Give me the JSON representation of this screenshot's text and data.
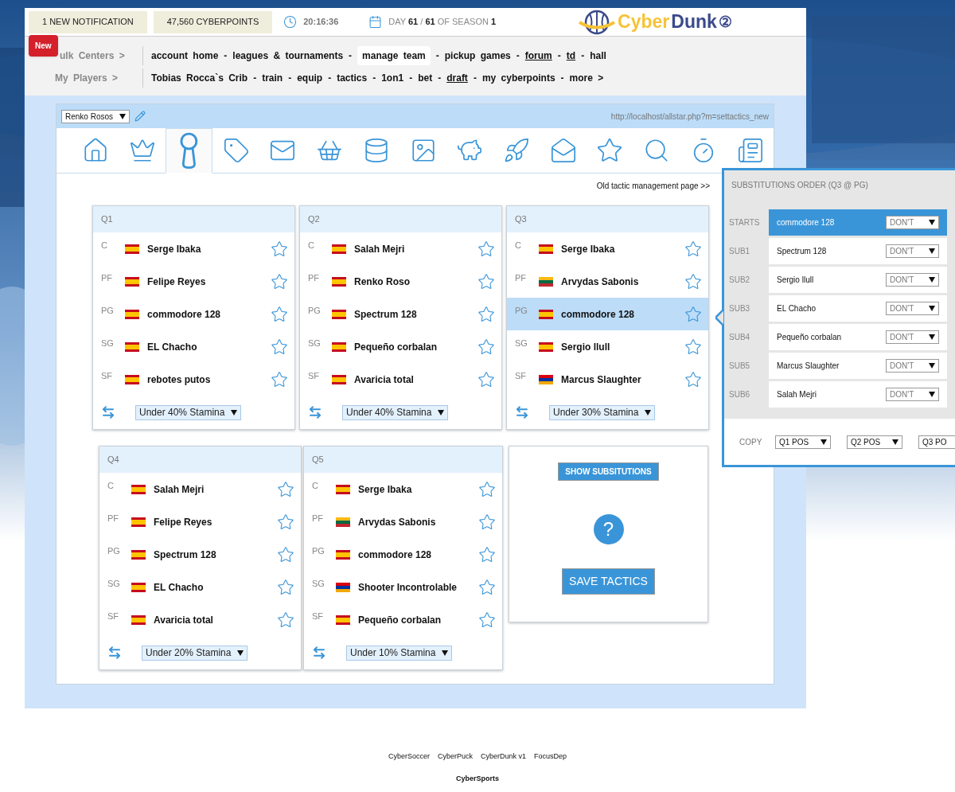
{
  "header": {
    "notification": "1 NEW NOTIFICATION",
    "badge": "New",
    "points": "47,560 CYBERPOINTS",
    "time": "20:16:36",
    "day": "DAY **61** / **61** OF SEASON **1**",
    "logo": [
      "Cyber",
      "Dunk",
      "②"
    ]
  },
  "nav": [
    {
      "label": "ulk Centers >",
      "separator": "-",
      "items": [
        {
          "text": "account home",
          "underlined": false,
          "selected": false
        },
        {
          "text": "leagues & tournaments",
          "underlined": false,
          "selected": false
        },
        {
          "text": "manage team",
          "underlined": false,
          "selected": true
        },
        {
          "text": "pickup games",
          "underlined": false,
          "selected": false
        },
        {
          "text": "forum",
          "underlined": true,
          "selected": false
        },
        {
          "text": "td",
          "underlined": true,
          "selected": false
        },
        {
          "text": "hall",
          "underlined": false,
          "selected": false
        }
      ]
    },
    {
      "label": "My Players >",
      "separator": "-",
      "items": [
        {
          "text": "Tobias Rocca`s Crib",
          "underlined": false,
          "selected": false
        },
        {
          "text": "train",
          "underlined": false,
          "selected": false
        },
        {
          "text": "equip",
          "underlined": false,
          "selected": false
        },
        {
          "text": "tactics",
          "underlined": false,
          "selected": false
        },
        {
          "text": "1on1",
          "underlined": false,
          "selected": false
        },
        {
          "text": "bet",
          "underlined": false,
          "selected": false
        },
        {
          "text": "draft",
          "underlined": true,
          "selected": false
        },
        {
          "text": "my cyberpoints",
          "underlined": false,
          "selected": false
        },
        {
          "text": "more >",
          "underlined": false,
          "selected": false
        }
      ]
    }
  ],
  "panel": {
    "player_select": "Renko Rosos",
    "url": "http://localhost/allstar.php?m=settactics_new",
    "old_link": "Old tactic management page >>"
  },
  "toolbar": [
    {
      "selected": false
    },
    {
      "selected": false
    },
    {
      "selected": true
    },
    {
      "selected": false
    },
    {
      "selected": false
    },
    {
      "selected": false
    },
    {
      "selected": false
    },
    {
      "selected": false
    },
    {
      "selected": false
    },
    {
      "selected": false
    },
    {
      "selected": false
    },
    {
      "selected": false
    },
    {
      "selected": false
    },
    {
      "selected": false
    },
    {
      "selected": false
    }
  ],
  "quarters": [
    {
      "title": "Q1",
      "stamina": "Under 40% Stamina",
      "rows": [
        {
          "pos": "C",
          "kind": "spain",
          "name": "Serge Ibaka",
          "selected": false
        },
        {
          "pos": "PF",
          "kind": "spain",
          "name": "Felipe Reyes",
          "selected": false
        },
        {
          "pos": "PG",
          "kind": "spain",
          "name": "commodore 128",
          "selected": false
        },
        {
          "pos": "SG",
          "kind": "spain",
          "name": "EL Chacho",
          "selected": false
        },
        {
          "pos": "SF",
          "kind": "spain",
          "name": "rebotes putos",
          "selected": false
        }
      ]
    },
    {
      "title": "Q2",
      "stamina": "Under 40% Stamina",
      "rows": [
        {
          "pos": "C",
          "kind": "spain",
          "name": "Salah Mejri",
          "selected": false
        },
        {
          "pos": "PF",
          "kind": "spain",
          "name": "Renko Roso",
          "selected": false
        },
        {
          "pos": "PG",
          "kind": "spain",
          "name": "Spectrum 128",
          "selected": false
        },
        {
          "pos": "SG",
          "kind": "spain",
          "name": "Pequeño corbalan",
          "selected": false
        },
        {
          "pos": "SF",
          "kind": "spain",
          "name": "Avaricia total",
          "selected": false
        }
      ]
    },
    {
      "title": "Q3",
      "stamina": "Under 30% Stamina",
      "rows": [
        {
          "pos": "C",
          "kind": "spain",
          "name": "Serge Ibaka",
          "selected": false
        },
        {
          "pos": "PF",
          "kind": "lithuania",
          "name": "Arvydas Sabonis",
          "selected": false
        },
        {
          "pos": "PG",
          "kind": "spain",
          "name": "commodore 128",
          "selected": true
        },
        {
          "pos": "SG",
          "kind": "spain",
          "name": "Sergio llull",
          "selected": false
        },
        {
          "pos": "SF",
          "kind": "armenia",
          "name": "Marcus Slaughter",
          "selected": false
        }
      ]
    },
    {
      "title": "Q4",
      "stamina": "Under 20% Stamina",
      "rows": [
        {
          "pos": "C",
          "kind": "spain",
          "name": "Salah Mejri",
          "selected": false
        },
        {
          "pos": "PF",
          "kind": "spain",
          "name": "Felipe Reyes",
          "selected": false
        },
        {
          "pos": "PG",
          "kind": "spain",
          "name": "Spectrum 128",
          "selected": false
        },
        {
          "pos": "SG",
          "kind": "spain",
          "name": "EL Chacho",
          "selected": false
        },
        {
          "pos": "SF",
          "kind": "spain",
          "name": "Avaricia total",
          "selected": false
        }
      ]
    },
    {
      "title": "Q5",
      "stamina": "Under 10% Stamina",
      "rows": [
        {
          "pos": "C",
          "kind": "spain",
          "name": "Serge Ibaka",
          "selected": false
        },
        {
          "pos": "PF",
          "kind": "lithuania",
          "name": "Arvydas Sabonis",
          "selected": false
        },
        {
          "pos": "PG",
          "kind": "spain",
          "name": "commodore 128",
          "selected": false
        },
        {
          "pos": "SG",
          "kind": "armenia",
          "name": "Shooter Incontrolable",
          "selected": false
        },
        {
          "pos": "SF",
          "kind": "spain",
          "name": "Pequeño corbalan",
          "selected": false
        }
      ]
    }
  ],
  "actions": {
    "show": "SHOW SUBSITUTIONS",
    "help": "?",
    "save": "SAVE TACTICS"
  },
  "substitutions": {
    "title": "SUBSTITUTIONS ORDER (Q3 @ PG)",
    "rows": [
      {
        "label": "STARTS",
        "name": "commodore 128",
        "choice": "DON'T",
        "selected": true
      },
      {
        "label": "SUB1",
        "name": "Spectrum 128",
        "choice": "DON'T",
        "selected": false
      },
      {
        "label": "SUB2",
        "name": "Sergio llull",
        "choice": "DON'T",
        "selected": false
      },
      {
        "label": "SUB3",
        "name": "EL Chacho",
        "choice": "DON'T",
        "selected": false
      },
      {
        "label": "SUB4",
        "name": "Pequeño corbalan",
        "choice": "DON'T",
        "selected": false
      },
      {
        "label": "SUB5",
        "name": "Marcus Slaughter",
        "choice": "DON'T",
        "selected": false
      },
      {
        "label": "SUB6",
        "name": "Salah Mejri",
        "choice": "DON'T",
        "selected": false
      }
    ],
    "copy_label": "COPY",
    "copy": [
      "Q1 POS",
      "Q2 POS",
      "Q3 PO"
    ]
  },
  "footer": {
    "links": [
      "CyberSoccer",
      "CyberPuck",
      "CyberDunk v1",
      "FocusDep"
    ],
    "brand": "CyberSports"
  }
}
